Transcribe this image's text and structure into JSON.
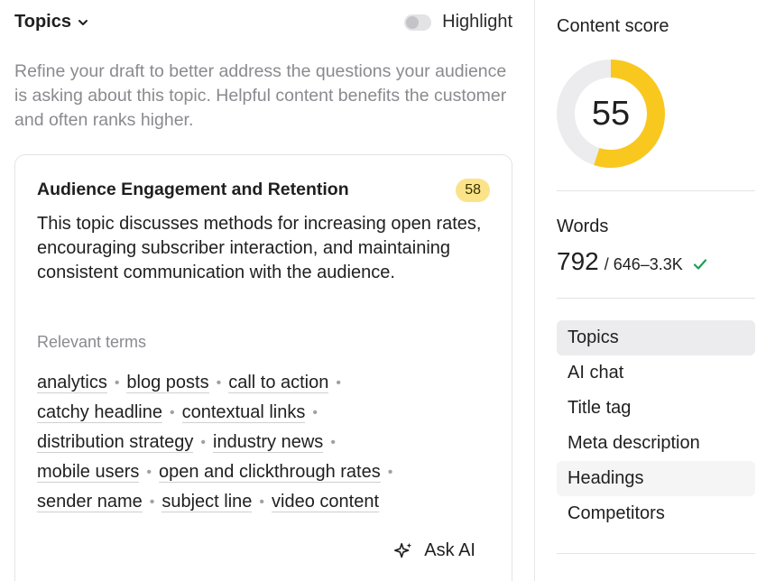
{
  "header": {
    "topics_label": "Topics",
    "highlight_label": "Highlight"
  },
  "intro": "Refine your draft to better address the questions your audience is asking about this topic. Helpful content benefits the customer and often ranks higher.",
  "topic_card": {
    "title": "Audience Engagement and Retention",
    "score": "58",
    "description": "This topic discusses methods for increasing open rates, encouraging subscriber interaction, and maintaining consistent communication with the audience.",
    "relevant_terms_label": "Relevant terms",
    "term_rows": [
      [
        "analytics",
        "blog posts",
        "call to action"
      ],
      [
        "catchy headline",
        "contextual links"
      ],
      [
        "distribution strategy",
        "industry news"
      ],
      [
        "mobile users",
        "open and clickthrough rates"
      ],
      [
        "sender name",
        "subject line",
        "video content"
      ]
    ],
    "ask_ai_label": "Ask AI"
  },
  "sidebar": {
    "content_score_label": "Content score",
    "content_score": 55,
    "score_max": 100,
    "score_color": "#f9c81f",
    "track_color": "#ececee",
    "words_label": "Words",
    "words_count": "792",
    "words_range": "/ 646–3.3K",
    "check_color": "#1f9d55",
    "nav_items": [
      {
        "label": "Topics",
        "state": "active"
      },
      {
        "label": "AI chat",
        "state": ""
      },
      {
        "label": "Title tag",
        "state": ""
      },
      {
        "label": "Meta description",
        "state": ""
      },
      {
        "label": "Headings",
        "state": "hover"
      },
      {
        "label": "Competitors",
        "state": ""
      }
    ]
  }
}
